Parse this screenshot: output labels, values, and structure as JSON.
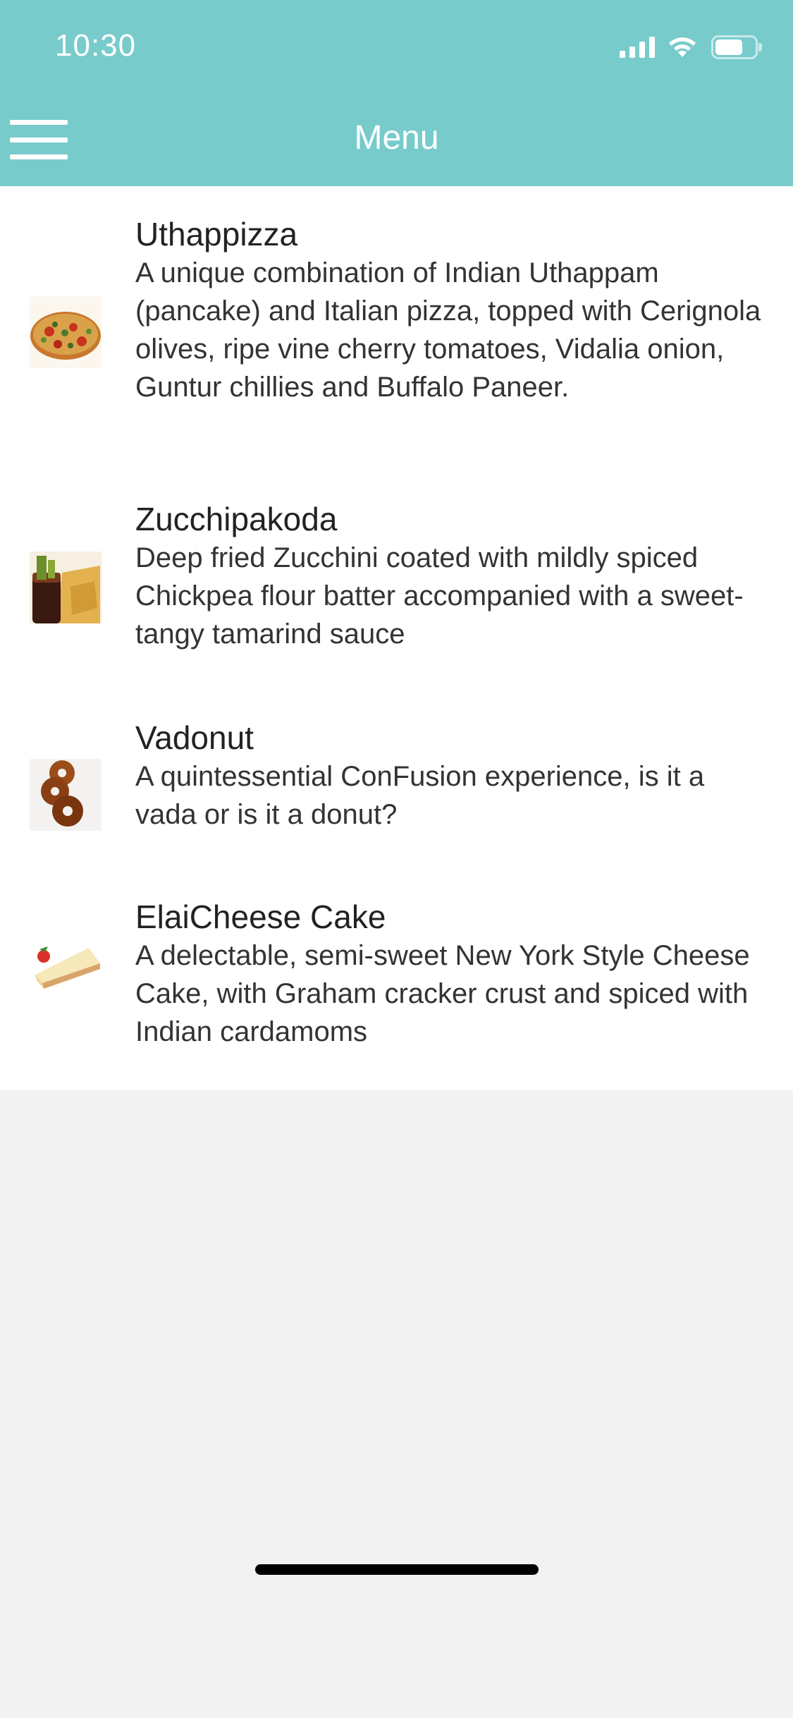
{
  "status_bar": {
    "time": "10:30"
  },
  "nav": {
    "title": "Menu",
    "menu_icon": "hamburger-icon"
  },
  "colors": {
    "header": "#78cbcb",
    "list_background": "#ffffff",
    "page_background": "#f2f2f2"
  },
  "dishes": [
    {
      "name": "Uthappizza",
      "description": "A unique combination of Indian Uthappam (pancake) and Italian pizza, topped with Cerignola olives, ripe vine cherry tomatoes, Vidalia onion, Guntur chillies and Buffalo Paneer.",
      "image": "pizza-thumbnail"
    },
    {
      "name": "Zucchipakoda",
      "description": "Deep fried Zucchini coated with mildly spiced Chickpea flour batter accompanied with a sweet-tangy tamarind sauce",
      "image": "pakoda-thumbnail"
    },
    {
      "name": "Vadonut",
      "description": "A quintessential ConFusion experience, is it a vada or is it a donut?",
      "image": "donut-thumbnail"
    },
    {
      "name": "ElaiCheese Cake",
      "description": "A delectable, semi-sweet New York Style Cheese Cake, with Graham cracker crust and spiced with Indian cardamoms",
      "image": "cheesecake-thumbnail"
    }
  ]
}
